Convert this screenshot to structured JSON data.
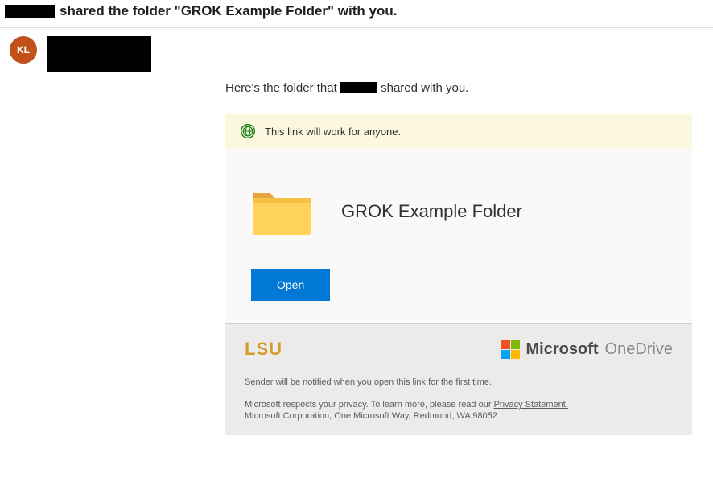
{
  "subject_prefix": "",
  "subject_main": "shared the folder \"GROK Example Folder\" with you.",
  "avatar_initials": "KL",
  "intro_before": "Here's the folder that ",
  "intro_after": " shared with you.",
  "banner": "This link will work for anyone.",
  "folder_name": "GROK Example Folder",
  "open_label": "Open",
  "lsu": "LSU",
  "ms": "Microsoft",
  "onedrive": "OneDrive",
  "notice": "Sender will be notified when you open this link for the first time.",
  "privacy_before": "Microsoft respects your privacy. To learn more, please read our ",
  "privacy_link": "Privacy Statement.",
  "corp": "Microsoft Corporation, One Microsoft Way, Redmond, WA 98052"
}
